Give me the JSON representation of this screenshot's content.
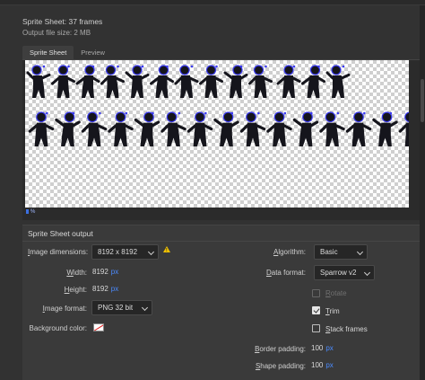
{
  "header": {
    "title": "Sprite Sheet: 37 frames",
    "subtitle": "Output file size: 2 MB"
  },
  "tabs": [
    {
      "label": "Sprite Sheet",
      "active": true
    },
    {
      "label": "Preview",
      "active": false
    }
  ],
  "preview": {
    "zoom_text": "%",
    "frame_count": 37
  },
  "output": {
    "section_title": "Sprite Sheet output",
    "image_dimensions": {
      "label": "Image dimensions:",
      "accel": "I",
      "value": "8192 x 8192"
    },
    "width": {
      "label": "Width:",
      "accel": "W",
      "value": "8192",
      "unit": "px"
    },
    "height": {
      "label": "Height:",
      "accel": "H",
      "value": "8192",
      "unit": "px"
    },
    "image_format": {
      "label": "Image format:",
      "accel": "I",
      "value": "PNG 32 bit"
    },
    "background_color": {
      "label": "Background color:"
    },
    "algorithm": {
      "label": "Algorithm:",
      "accel": "A",
      "value": "Basic"
    },
    "data_format": {
      "label": "Data format:",
      "accel": "D",
      "value": "Sparrow v2"
    },
    "rotate": {
      "label": "Rotate",
      "accel": "R",
      "checked": false,
      "disabled": true
    },
    "trim": {
      "label": "Trim",
      "accel": "T",
      "checked": true,
      "disabled": false
    },
    "stack_frames": {
      "label": "Stack frames",
      "accel": "S",
      "checked": false,
      "disabled": false
    },
    "border_padding": {
      "label": "Border padding:",
      "accel": "B",
      "value": "100",
      "unit": "px"
    },
    "shape_padding": {
      "label": "Shape padding:",
      "accel": "S",
      "value": "100",
      "unit": "px"
    }
  },
  "colors": {
    "accent_blue": "#4b8bff",
    "warning": "#f2c200",
    "sprite_fill": "#15151c",
    "sprite_glow": "#3a3af0"
  }
}
